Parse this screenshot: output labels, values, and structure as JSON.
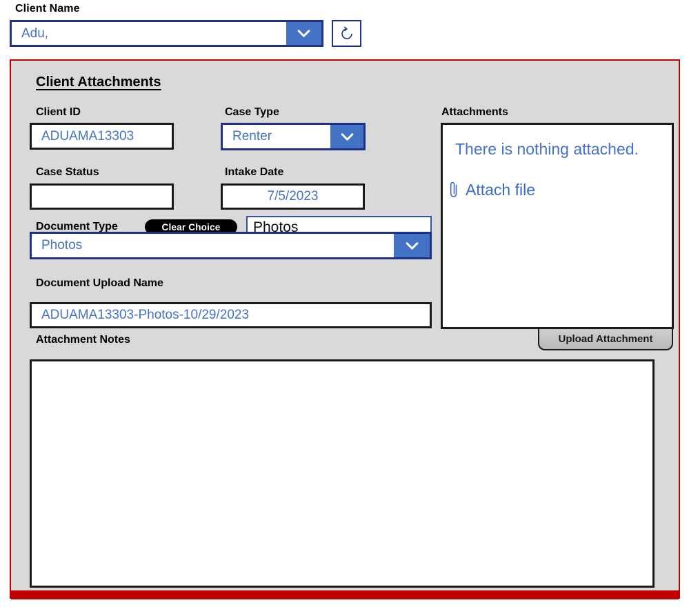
{
  "topbar": {
    "client_name_label": "Client Name",
    "client_name_value": "Adu,",
    "refresh_icon": "refresh-circular-arrow-icon",
    "dropdown_icon": "chevron-down-icon"
  },
  "panel": {
    "section_title": "Client Attachments",
    "accent_color": "#c00000",
    "background_color": "#d9d9d9"
  },
  "fields": {
    "client_id": {
      "label": "Client ID",
      "value": "ADUAMA13303"
    },
    "case_type": {
      "label": "Case Type",
      "value": "Renter"
    },
    "case_status": {
      "label": "Case Status",
      "value": ""
    },
    "intake_date": {
      "label": "Intake Date",
      "value": "7/5/2023"
    },
    "document_type": {
      "label": "Document Type",
      "clear_choice_label": "Clear Choice",
      "text_value": "Photos",
      "dropdown_value": "Photos"
    },
    "document_upload_name": {
      "label": "Document Upload Name",
      "value": "ADUAMA13303-Photos-10/29/2023"
    },
    "attachment_notes": {
      "label": "Attachment Notes",
      "value": ""
    }
  },
  "attachments": {
    "label": "Attachments",
    "empty_message": "There is nothing attached.",
    "attach_file_label": "Attach file",
    "attach_icon": "paperclip-icon",
    "upload_button_label": "Upload Attachment"
  },
  "colors": {
    "link_blue": "#4472c4",
    "navy_border": "#1f3283",
    "red_accent": "#c00000"
  }
}
